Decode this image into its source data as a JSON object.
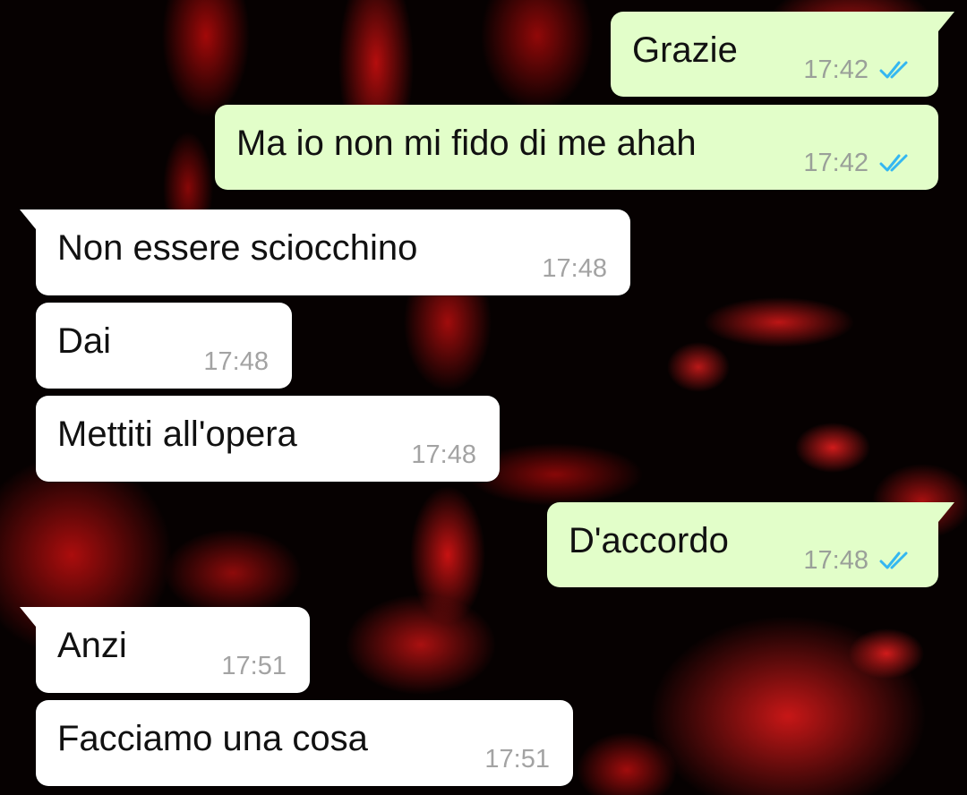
{
  "colors": {
    "outgoing_bubble": "#e2fec9",
    "incoming_bubble": "#ffffff",
    "read_ticks": "#34b7f1",
    "timestamp": "#9aa099",
    "wallpaper_base": "#060101",
    "wallpaper_splatter": "#d21818"
  },
  "wallpaper": {
    "description_icon": "blood-splatter-wallpaper"
  },
  "messages": [
    {
      "direction": "outgoing",
      "text": "Grazie",
      "time": "17:42",
      "status_icon": "double-check-read-icon"
    },
    {
      "direction": "outgoing",
      "text": "Ma io non mi fido di me ahah",
      "time": "17:42",
      "status_icon": "double-check-read-icon"
    },
    {
      "direction": "incoming",
      "text": "Non essere sciocchino",
      "time": "17:48"
    },
    {
      "direction": "incoming",
      "text": "Dai",
      "time": "17:48"
    },
    {
      "direction": "incoming",
      "text": "Mettiti all'opera",
      "time": "17:48"
    },
    {
      "direction": "outgoing",
      "text": "D'accordo",
      "time": "17:48",
      "status_icon": "double-check-read-icon"
    },
    {
      "direction": "incoming",
      "text": "Anzi",
      "time": "17:51"
    },
    {
      "direction": "incoming",
      "text": "Facciamo una cosa",
      "time": "17:51"
    }
  ]
}
